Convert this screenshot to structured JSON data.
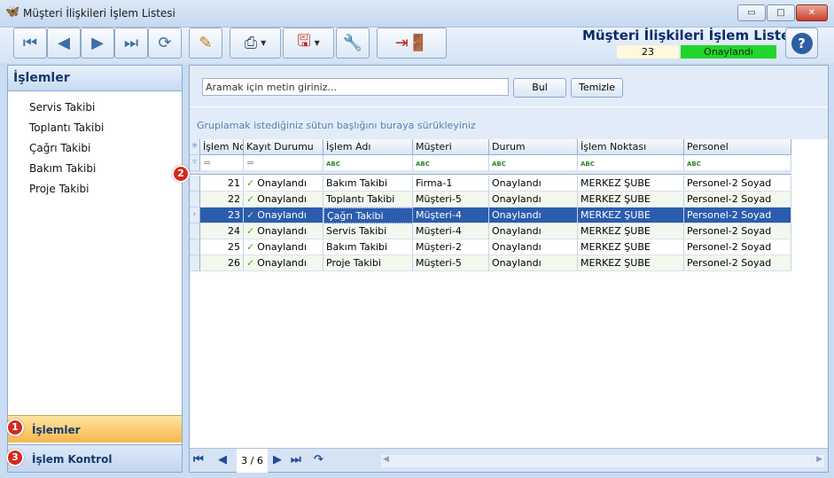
{
  "window": {
    "title": "Müşteri İlişkileri İşlem Listesi",
    "controls": {
      "minimize": "▭",
      "maximize": "□",
      "close": "✕"
    }
  },
  "toolbar": {
    "icons": [
      "first-icon",
      "prev-icon",
      "next-icon",
      "last-icon",
      "refresh-icon",
      "edit-icon",
      "print-icon",
      "export-pdf-icon",
      "tools-icon",
      "exit-icon",
      "help-icon"
    ],
    "page_title": "Müşteri İlişkileri İşlem Listesi",
    "record_id": "23",
    "record_status": "Onaylandı"
  },
  "nav": {
    "header": "İşlemler",
    "items": [
      "Servis Takibi",
      "Toplantı Takibi",
      "Çağrı Takibi",
      "Bakım Takibi",
      "Proje Takibi"
    ],
    "groups": [
      {
        "label": "İşlemler",
        "active": true,
        "badge": "1"
      },
      {
        "label": "İşlem Kontrol",
        "active": false,
        "badge": "3"
      }
    ]
  },
  "search": {
    "placeholder": "Aramak için metin giriniz...",
    "find_label": "Bul",
    "clear_label": "Temizle"
  },
  "grid": {
    "group_hint": "Gruplamak istediğiniz sütun başlığını buraya sürükleyiniz",
    "filter_badge": "2",
    "columns": [
      "İşlem No",
      "Kayıt Durumu",
      "İşlem Adı",
      "Müşteri",
      "Durum",
      "İşlem Noktası",
      "Personel"
    ],
    "filter_ops": [
      "=",
      "=",
      "ABC",
      "ABC",
      "ABC",
      "ABC",
      "ABC"
    ],
    "rows": [
      [
        "21",
        "Onaylandı",
        "Bakım Takibi",
        "Firma-1",
        "Onaylandı",
        "MERKEZ ŞUBE",
        "Personel-2 Soyad"
      ],
      [
        "22",
        "Onaylandı",
        "Toplantı Takibi",
        "Müşteri-5",
        "Onaylandı",
        "MERKEZ ŞUBE",
        "Personel-2 Soyad"
      ],
      [
        "23",
        "Onaylandı",
        "Çağrı Takibi",
        "Müşteri-4",
        "Onaylandı",
        "MERKEZ ŞUBE",
        "Personel-2 Soyad"
      ],
      [
        "24",
        "Onaylandı",
        "Servis Takibi",
        "Müşteri-4",
        "Onaylandı",
        "MERKEZ ŞUBE",
        "Personel-2 Soyad"
      ],
      [
        "25",
        "Onaylandı",
        "Bakım Takibi",
        "Müşteri-2",
        "Onaylandı",
        "MERKEZ ŞUBE",
        "Personel-2 Soyad"
      ],
      [
        "26",
        "Onaylandı",
        "Proje Takibi",
        "Müşteri-5",
        "Onaylandı",
        "MERKEZ ŞUBE",
        "Personel-2 Soyad"
      ]
    ],
    "selected_row": 2
  },
  "navigator": {
    "page_indicator": "3 / 6"
  },
  "colors": {
    "selection": "#2b5cae",
    "status_green": "#22d52b",
    "badge_red": "#d32a1e",
    "active_group": "#f7b74c"
  }
}
